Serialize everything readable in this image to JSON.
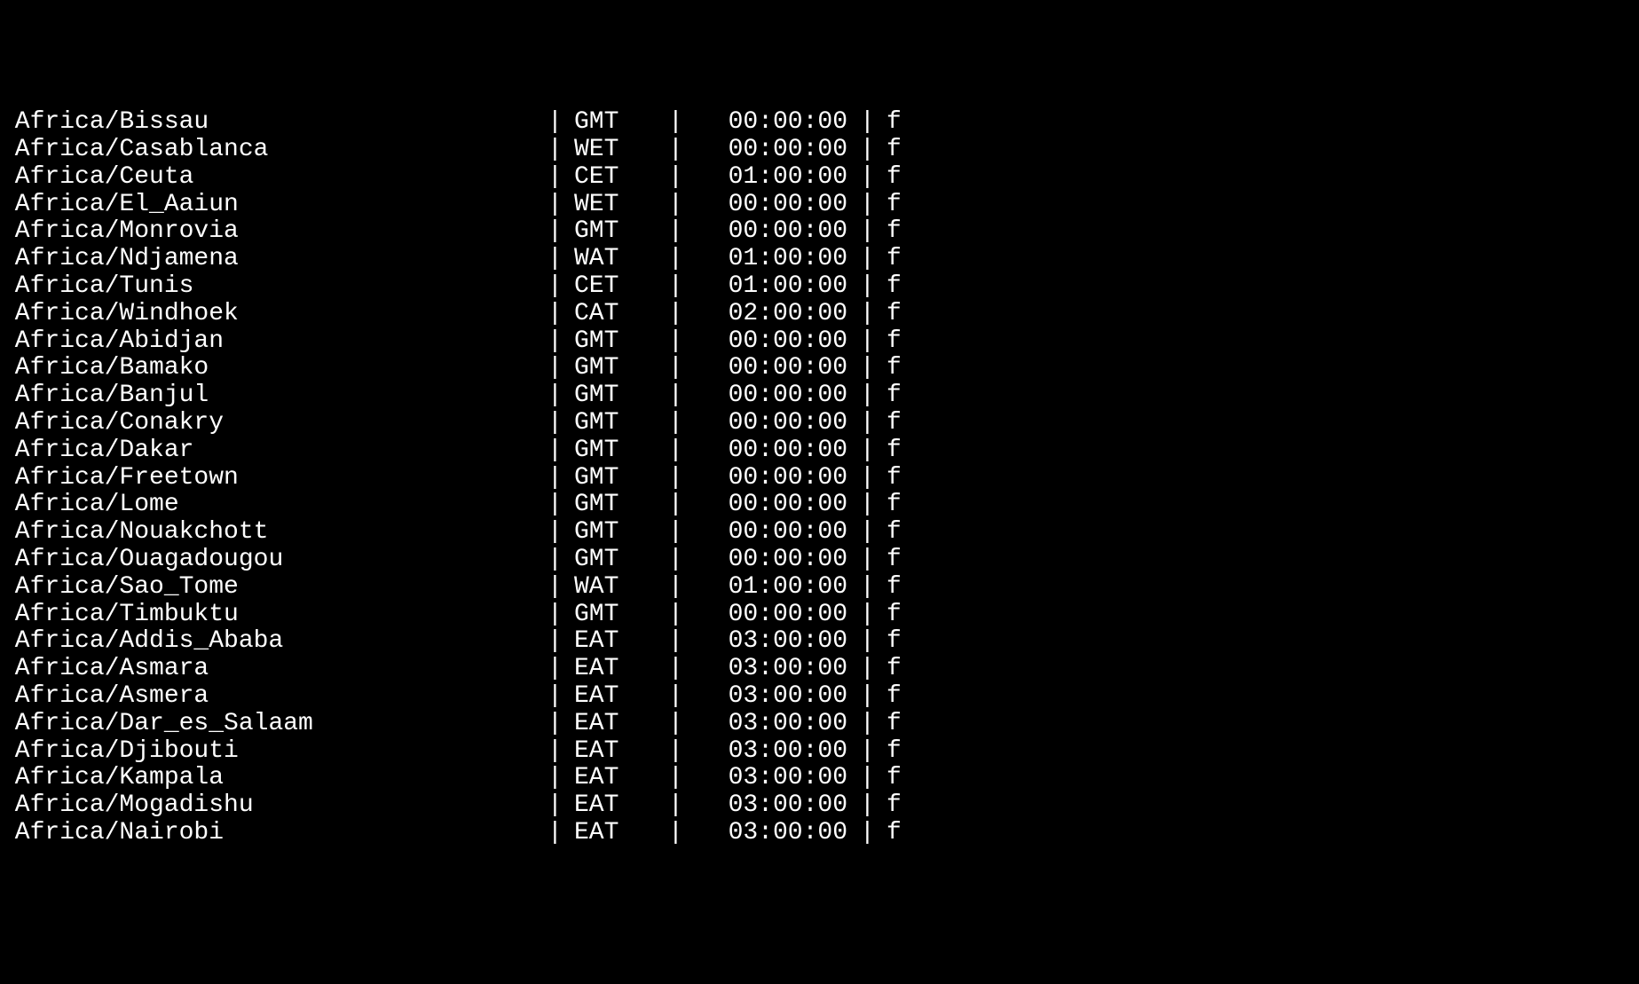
{
  "separator": "|",
  "rows": [
    {
      "name": " Africa/Bissau",
      "abbrev": "GMT",
      "offset": "00:00:00",
      "dst": "f"
    },
    {
      "name": " Africa/Casablanca",
      "abbrev": "WET",
      "offset": "00:00:00",
      "dst": "f"
    },
    {
      "name": " Africa/Ceuta",
      "abbrev": "CET",
      "offset": "01:00:00",
      "dst": "f"
    },
    {
      "name": " Africa/El_Aaiun",
      "abbrev": "WET",
      "offset": "00:00:00",
      "dst": "f"
    },
    {
      "name": " Africa/Monrovia",
      "abbrev": "GMT",
      "offset": "00:00:00",
      "dst": "f"
    },
    {
      "name": " Africa/Ndjamena",
      "abbrev": "WAT",
      "offset": "01:00:00",
      "dst": "f"
    },
    {
      "name": " Africa/Tunis",
      "abbrev": "CET",
      "offset": "01:00:00",
      "dst": "f"
    },
    {
      "name": " Africa/Windhoek",
      "abbrev": "CAT",
      "offset": "02:00:00",
      "dst": "f"
    },
    {
      "name": " Africa/Abidjan",
      "abbrev": "GMT",
      "offset": "00:00:00",
      "dst": "f"
    },
    {
      "name": " Africa/Bamako",
      "abbrev": "GMT",
      "offset": "00:00:00",
      "dst": "f"
    },
    {
      "name": " Africa/Banjul",
      "abbrev": "GMT",
      "offset": "00:00:00",
      "dst": "f"
    },
    {
      "name": " Africa/Conakry",
      "abbrev": "GMT",
      "offset": "00:00:00",
      "dst": "f"
    },
    {
      "name": " Africa/Dakar",
      "abbrev": "GMT",
      "offset": "00:00:00",
      "dst": "f"
    },
    {
      "name": " Africa/Freetown",
      "abbrev": "GMT",
      "offset": "00:00:00",
      "dst": "f"
    },
    {
      "name": " Africa/Lome",
      "abbrev": "GMT",
      "offset": "00:00:00",
      "dst": "f"
    },
    {
      "name": " Africa/Nouakchott",
      "abbrev": "GMT",
      "offset": "00:00:00",
      "dst": "f"
    },
    {
      "name": " Africa/Ouagadougou",
      "abbrev": "GMT",
      "offset": "00:00:00",
      "dst": "f"
    },
    {
      "name": " Africa/Sao_Tome",
      "abbrev": "WAT",
      "offset": "01:00:00",
      "dst": "f"
    },
    {
      "name": " Africa/Timbuktu",
      "abbrev": "GMT",
      "offset": "00:00:00",
      "dst": "f"
    },
    {
      "name": " Africa/Addis_Ababa",
      "abbrev": "EAT",
      "offset": "03:00:00",
      "dst": "f"
    },
    {
      "name": " Africa/Asmara",
      "abbrev": "EAT",
      "offset": "03:00:00",
      "dst": "f"
    },
    {
      "name": " Africa/Asmera",
      "abbrev": "EAT",
      "offset": "03:00:00",
      "dst": "f"
    },
    {
      "name": " Africa/Dar_es_Salaam",
      "abbrev": "EAT",
      "offset": "03:00:00",
      "dst": "f"
    },
    {
      "name": " Africa/Djibouti",
      "abbrev": "EAT",
      "offset": "03:00:00",
      "dst": "f"
    },
    {
      "name": " Africa/Kampala",
      "abbrev": "EAT",
      "offset": "03:00:00",
      "dst": "f"
    },
    {
      "name": " Africa/Mogadishu",
      "abbrev": "EAT",
      "offset": "03:00:00",
      "dst": "f"
    },
    {
      "name": " Africa/Nairobi",
      "abbrev": "EAT",
      "offset": "03:00:00",
      "dst": "f"
    }
  ]
}
